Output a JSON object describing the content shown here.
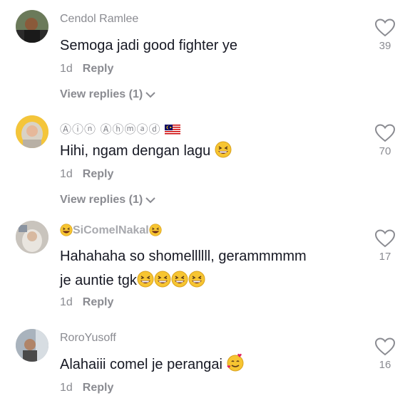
{
  "comments": [
    {
      "username": "Cendol Ramlee",
      "text": "Semoga jadi good fighter ye",
      "time": "1d",
      "reply": "Reply",
      "view_replies": "View replies (1)",
      "likes": "39"
    },
    {
      "username": "Ⓐⓘⓝ Ⓐⓗⓜⓐⓓ",
      "text": "Hihi, ngam dengan lagu",
      "time": "1d",
      "reply": "Reply",
      "view_replies": "View replies (1)",
      "likes": "70"
    },
    {
      "username": "SiComelNakal",
      "text_line1": "Hahahaha so shomellllll, gerammmmm",
      "text_line2": "je auntie tgk",
      "time": "1d",
      "reply": "Reply",
      "likes": "17"
    },
    {
      "username": "RoroYusoff",
      "text": "Alahaiii comel je perangai",
      "time": "1d",
      "reply": "Reply",
      "likes": "16"
    }
  ],
  "colors": {
    "text": "#161823",
    "muted": "#8a8b91",
    "emoji": "#f7c531"
  },
  "icons": [
    "heart-icon",
    "chevron-down-icon",
    "grinning-squinting-emoji",
    "smiling-face-with-hearts-emoji",
    "malaysia-flag-icon"
  ]
}
